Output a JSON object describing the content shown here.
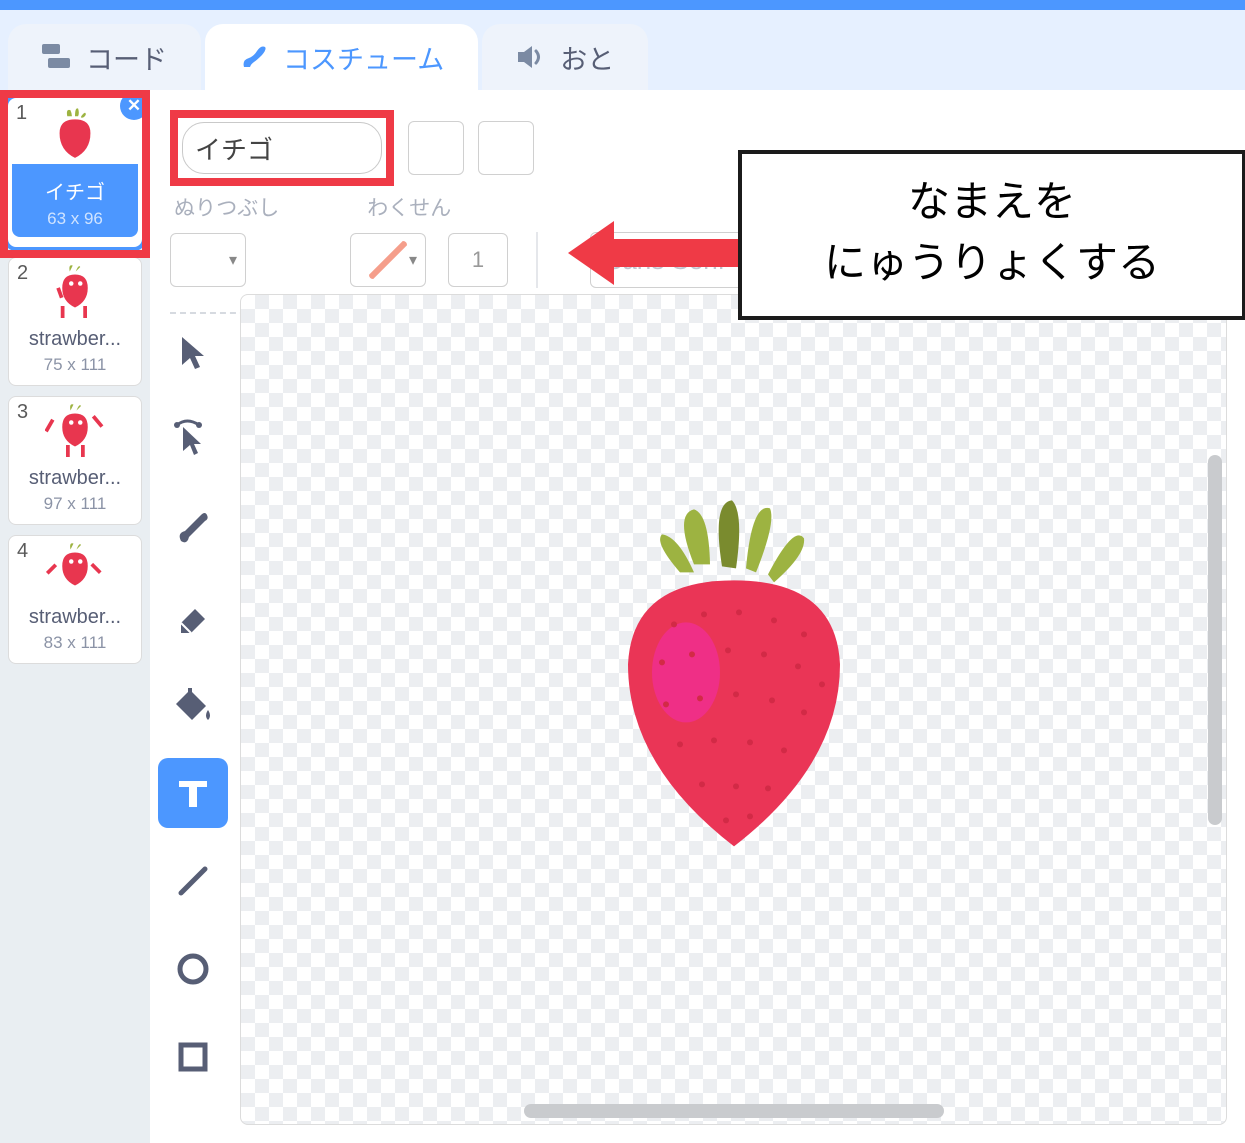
{
  "tabs": {
    "code": "コード",
    "costumes": "コスチューム",
    "sounds": "おと"
  },
  "nameInput": {
    "value": "イチゴ"
  },
  "labels": {
    "fill": "ぬりつぶし",
    "outline": "わくせん"
  },
  "outlineWidth": "1",
  "fontSelect": "Sans Serif",
  "annotation": {
    "line1": "なまえを",
    "line2": "にゅうりょくする"
  },
  "costumes": [
    {
      "num": "1",
      "name": "イチゴ",
      "dim": "63 x 96",
      "selected": true
    },
    {
      "num": "2",
      "name": "strawber...",
      "dim": "75 x 111",
      "selected": false
    },
    {
      "num": "3",
      "name": "strawber...",
      "dim": "97 x 111",
      "selected": false
    },
    {
      "num": "4",
      "name": "strawber...",
      "dim": "83 x 111",
      "selected": false
    }
  ],
  "tools": [
    {
      "id": "select",
      "active": false
    },
    {
      "id": "reshape",
      "active": false
    },
    {
      "id": "brush",
      "active": false
    },
    {
      "id": "eraser",
      "active": false
    },
    {
      "id": "fill",
      "active": false
    },
    {
      "id": "text",
      "active": true
    },
    {
      "id": "line",
      "active": false
    },
    {
      "id": "circle",
      "active": false
    },
    {
      "id": "rect",
      "active": false
    }
  ]
}
